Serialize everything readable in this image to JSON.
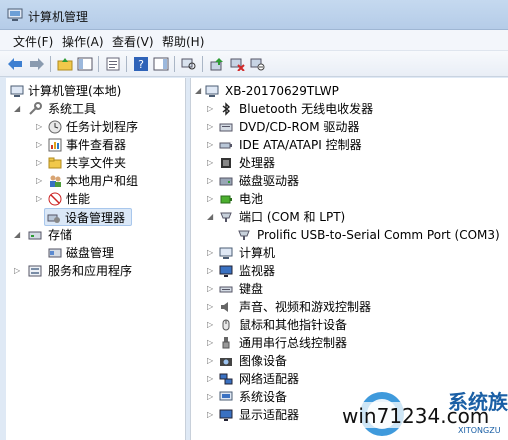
{
  "window": {
    "title": "计算机管理"
  },
  "menu": [
    "文件(F)",
    "操作(A)",
    "查看(V)",
    "帮助(H)"
  ],
  "left_tree": {
    "root": "计算机管理(本地)",
    "system_tools": "系统工具",
    "task_scheduler": "任务计划程序",
    "event_viewer": "事件查看器",
    "shared_folders": "共享文件夹",
    "local_users": "本地用户和组",
    "performance": "性能",
    "device_manager": "设备管理器",
    "storage": "存储",
    "disk_management": "磁盘管理",
    "services": "服务和应用程序"
  },
  "right_tree": {
    "computer_name": "XB-20170629TLWP",
    "items": [
      "Bluetooth 无线电收发器",
      "DVD/CD-ROM 驱动器",
      "IDE ATA/ATAPI 控制器",
      "处理器",
      "磁盘驱动器",
      "电池",
      "端口 (COM 和 LPT)",
      "Prolific USB-to-Serial Comm Port (COM3)",
      "计算机",
      "监视器",
      "键盘",
      "声音、视频和游戏控制器",
      "鼠标和其他指针设备",
      "通用串行总线控制器",
      "图像设备",
      "网络适配器",
      "系统设备",
      "显示适配器"
    ]
  },
  "watermark": {
    "text": "win71234.com",
    "brand": "系统族",
    "small": "XITONGZU"
  }
}
